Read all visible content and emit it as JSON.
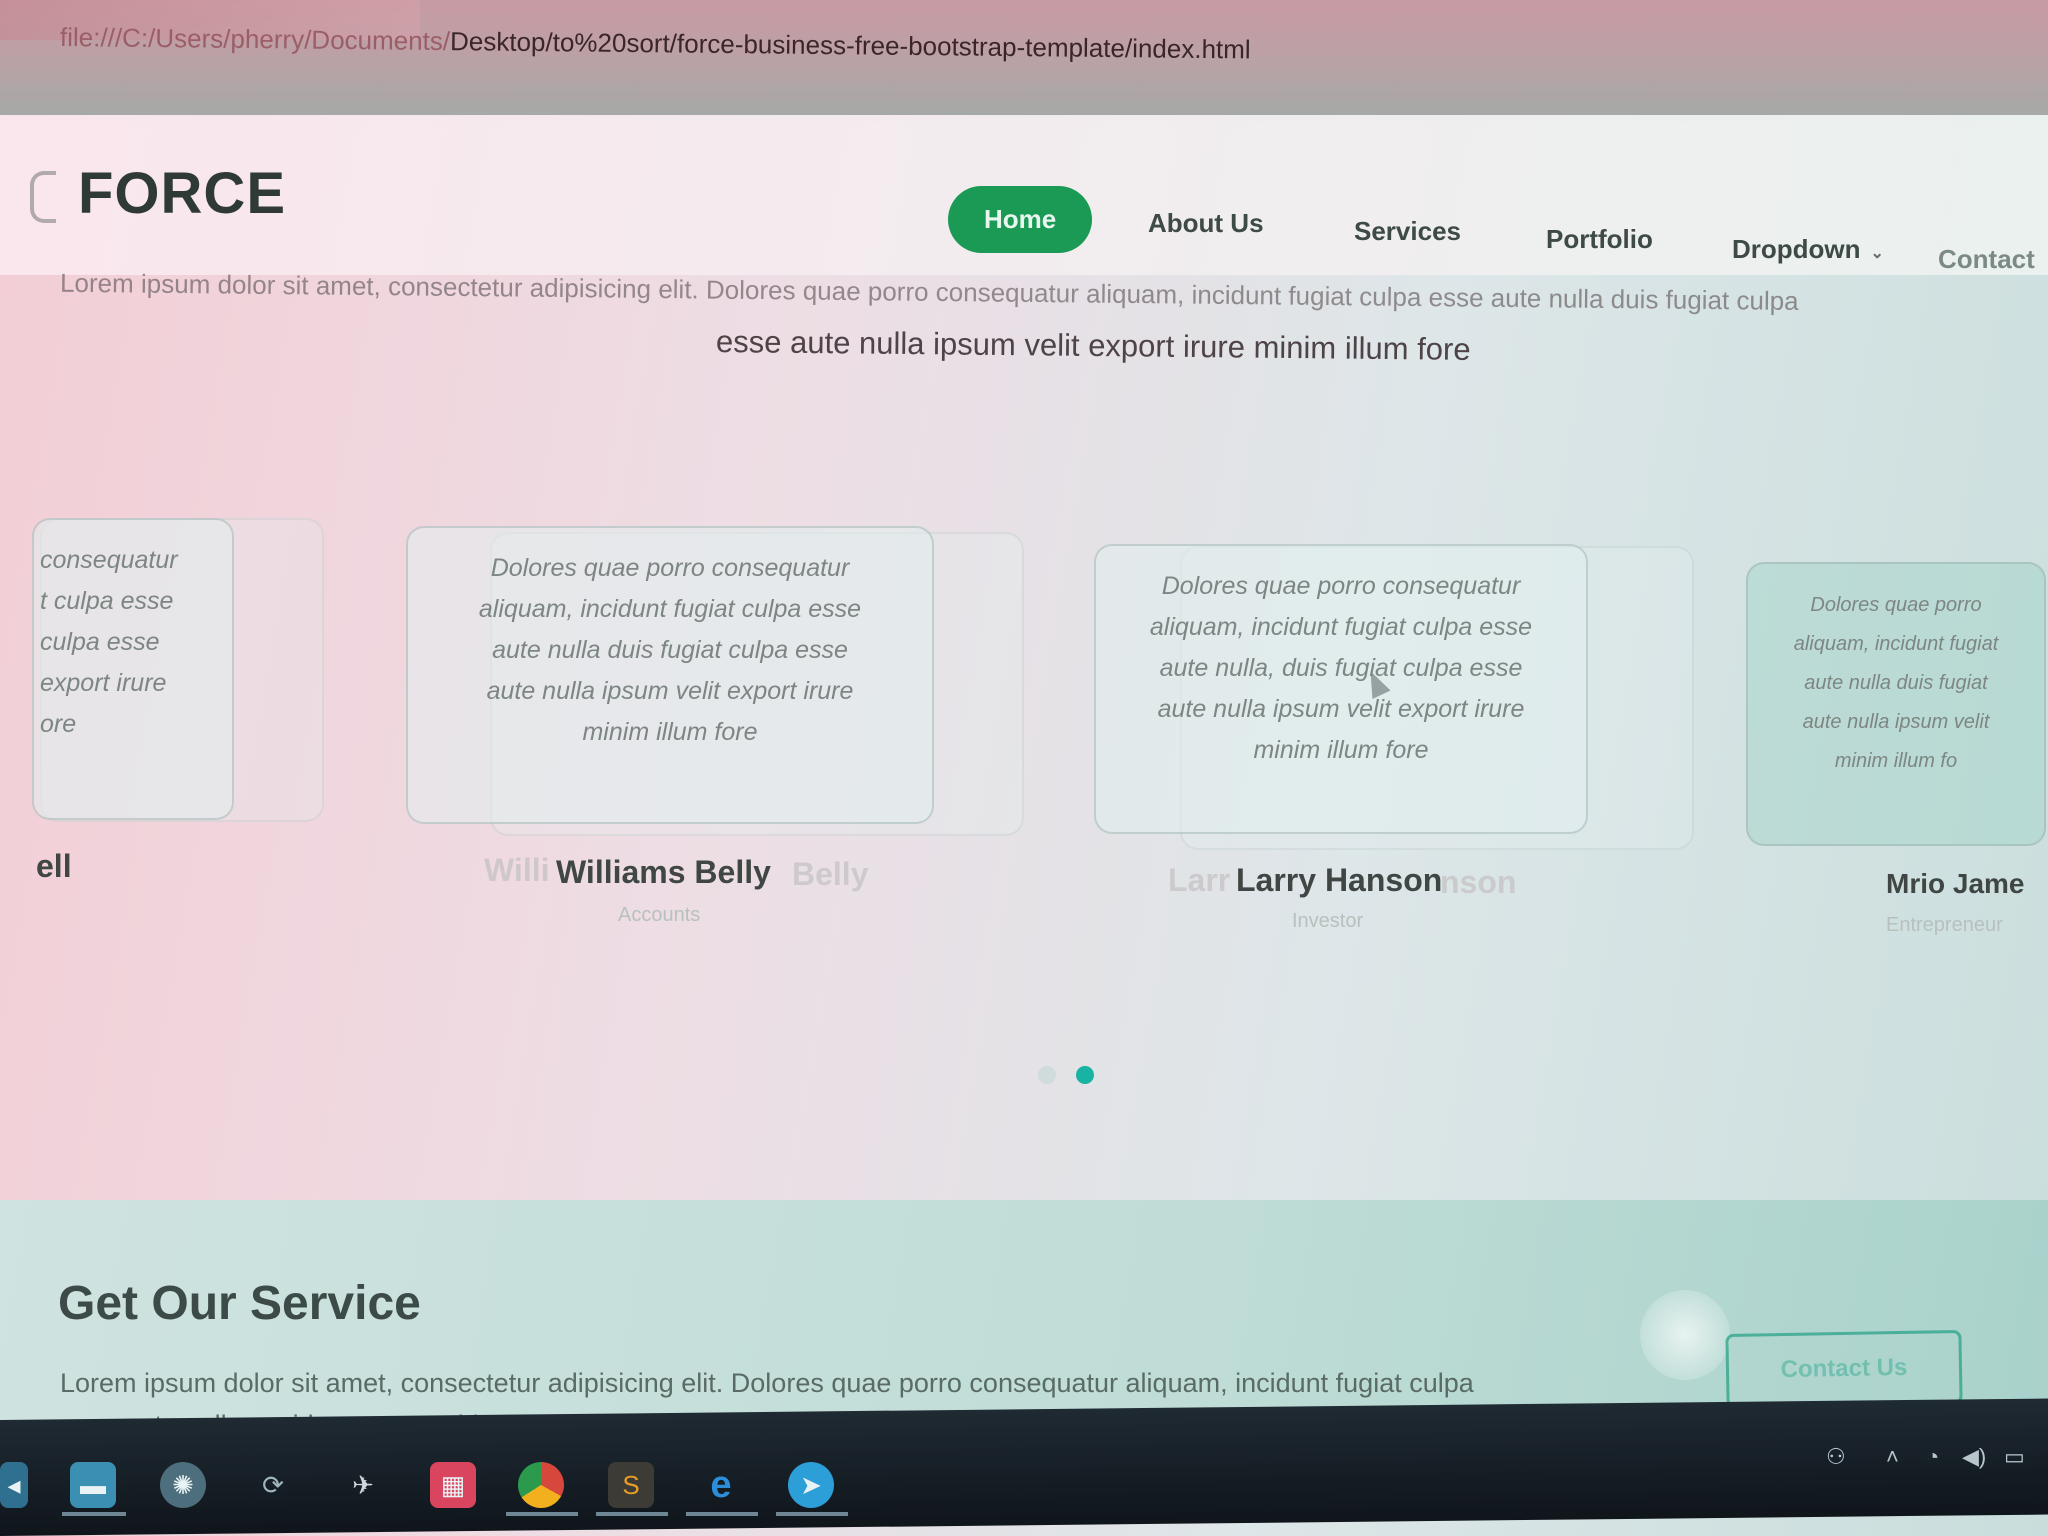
{
  "browser": {
    "url_prefix": "file:///C:/Users/pherry/Documents/",
    "url_visible": "Desktop/to%20sort/force-business-free-bootstrap-template/index.html"
  },
  "brand": {
    "name": "FORCE",
    "logo_icon": "force-logo-mark"
  },
  "nav": {
    "items": [
      {
        "label": "Home",
        "active": true
      },
      {
        "label": "About Us"
      },
      {
        "label": "Services"
      },
      {
        "label": "Portfolio"
      },
      {
        "label": "Dropdown"
      },
      {
        "label": "Contact"
      }
    ],
    "accent": "#1a9a55"
  },
  "hero": {
    "line_partial": "Lorem ipsum dolor sit amet, consectetur adipisicing elit. Dolores quae porro consequatur aliquam, incidunt fugiat culpa esse aute nulla duis fugiat culpa",
    "line": "esse aute nulla ipsum velit export irure minim illum fore"
  },
  "testimonials": {
    "left_card_lines": [
      "consequatur",
      "t culpa esse",
      "culpa esse",
      "export irure",
      "ore"
    ],
    "left_name": "ell",
    "cards": [
      {
        "lines": [
          "Dolores quae porro consequatur",
          "aliquam, incidunt fugiat culpa esse",
          "aute nulla duis fugiat culpa esse",
          "aute nulla ipsum velit export irure",
          "minim illum fore"
        ],
        "name": "Williams Belly",
        "role": "Accounts"
      },
      {
        "lines": [
          "Dolores quae porro consequatur",
          "aliquam, incidunt fugiat culpa esse",
          "aute nulla, duis fugiat culpa esse",
          "aute nulla ipsum velit export irure",
          "minim illum fore"
        ],
        "name": "Larry Hanson",
        "role": "Investor"
      },
      {
        "lines": [
          "Dolores quae porro",
          "aliquam, incidunt fugiat",
          "aute nulla duis fugiat",
          "aute nulla ipsum velit",
          "minim illum fo"
        ],
        "name": "Mrio Jame",
        "role": "Entrepreneur"
      }
    ],
    "ghost_names": [
      "Willi",
      "Belly",
      "Larr",
      "nson",
      "Kell"
    ],
    "carousel_dots": {
      "count": 2,
      "active_index": 1
    }
  },
  "service": {
    "title": "Get Our Service",
    "text": "Lorem ipsum dolor sit amet, consectetur adipisicing elit. Dolores quae porro consequatur aliquam, incidunt fugiat culpa esse aute nulla cupidatat non proident, sunt in culpa qui officia deserunt mollit anim id est laborum.",
    "button": "Contact Us"
  },
  "taskbar": {
    "icons": [
      "start-icon",
      "file-explorer-icon",
      "globe-icon",
      "sync-icon",
      "bird-icon",
      "calendar-app-icon",
      "chrome-icon",
      "sublime-text-icon",
      "edge-icon",
      "telegram-icon"
    ]
  }
}
